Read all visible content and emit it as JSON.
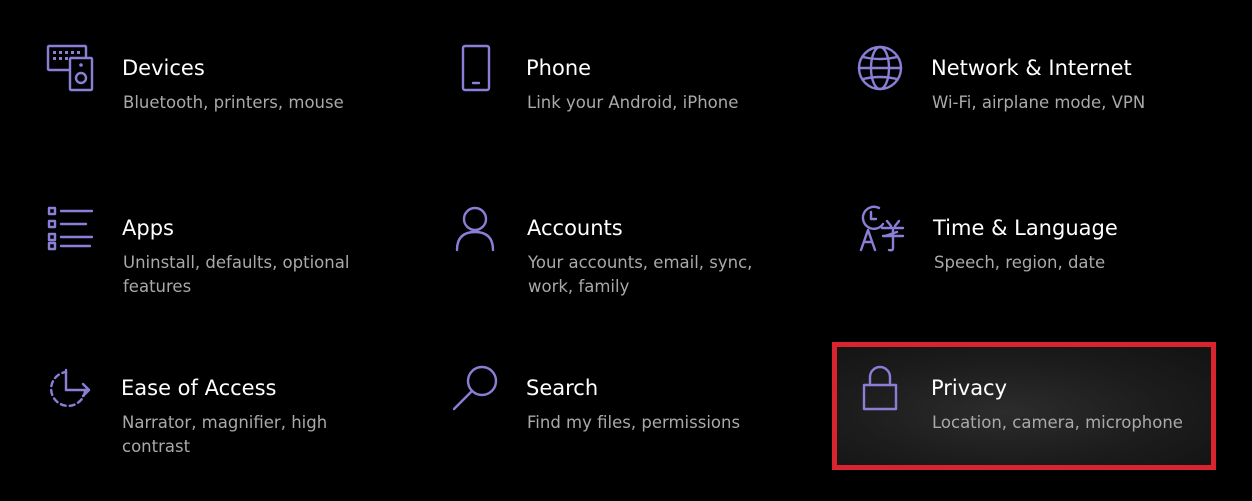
{
  "colors": {
    "background": "#000000",
    "accent_icon": "#8a7fd6",
    "title_text": "#ffffff",
    "desc_text": "#a9a9a9",
    "highlight_border": "#d9232e"
  },
  "tiles": [
    {
      "title": "Devices",
      "desc": "Bluetooth, printers, mouse",
      "icon": "devices-icon"
    },
    {
      "title": "Phone",
      "desc": "Link your Android, iPhone",
      "icon": "phone-icon"
    },
    {
      "title": "Network & Internet",
      "desc": "Wi-Fi, airplane mode, VPN",
      "icon": "globe-icon"
    },
    {
      "title": "Apps",
      "desc": "Uninstall, defaults, optional features",
      "icon": "apps-list-icon"
    },
    {
      "title": "Accounts",
      "desc": "Your accounts, email, sync, work, family",
      "icon": "person-icon"
    },
    {
      "title": "Time & Language",
      "desc": "Speech, region, date",
      "icon": "time-language-icon"
    },
    {
      "title": "Ease of Access",
      "desc": "Narrator, magnifier, high contrast",
      "icon": "ease-of-access-icon"
    },
    {
      "title": "Search",
      "desc": "Find my files, permissions",
      "icon": "search-icon"
    },
    {
      "title": "Privacy",
      "desc": "Location, camera, microphone",
      "icon": "lock-icon",
      "highlighted": true
    }
  ]
}
